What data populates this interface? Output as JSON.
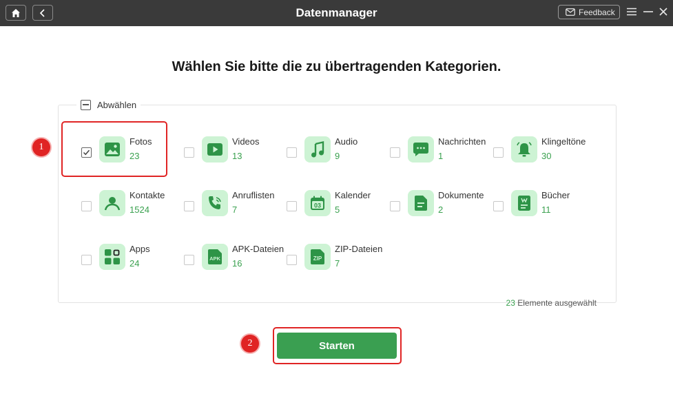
{
  "app": {
    "title": "Datenmanager",
    "feedback_label": "Feedback"
  },
  "main": {
    "heading": "Wählen Sie bitte die zu übertragenden Kategorien.",
    "deselect_label": "Abwählen",
    "summary_count": "23",
    "summary_text": "Elemente ausgewählt",
    "start_label": "Starten"
  },
  "annotations": {
    "badge1": "1",
    "badge2": "2"
  },
  "categories": [
    {
      "label": "Fotos",
      "count": "23",
      "checked": true,
      "icon": "photo-icon"
    },
    {
      "label": "Videos",
      "count": "13",
      "checked": false,
      "icon": "video-icon"
    },
    {
      "label": "Audio",
      "count": "9",
      "checked": false,
      "icon": "music-icon"
    },
    {
      "label": "Nachrichten",
      "count": "1",
      "checked": false,
      "icon": "message-icon"
    },
    {
      "label": "Klingeltöne",
      "count": "30",
      "checked": false,
      "icon": "bell-icon"
    },
    {
      "label": "Kontakte",
      "count": "1524",
      "checked": false,
      "icon": "contact-icon"
    },
    {
      "label": "Anruflisten",
      "count": "7",
      "checked": false,
      "icon": "phone-icon"
    },
    {
      "label": "Kalender",
      "count": "5",
      "checked": false,
      "icon": "calendar-icon"
    },
    {
      "label": "Dokumente",
      "count": "2",
      "checked": false,
      "icon": "document-icon"
    },
    {
      "label": "Bücher",
      "count": "11",
      "checked": false,
      "icon": "book-icon"
    },
    {
      "label": "Apps",
      "count": "24",
      "checked": false,
      "icon": "apps-icon"
    },
    {
      "label": "APK-Dateien",
      "count": "16",
      "checked": false,
      "icon": "apk-icon"
    },
    {
      "label": "ZIP-Dateien",
      "count": "7",
      "checked": false,
      "icon": "zip-icon"
    }
  ],
  "colors": {
    "accent": "#3aa14f",
    "tile": "#cdf3d4",
    "icon": "#2e9447",
    "highlight": "#e02424"
  }
}
